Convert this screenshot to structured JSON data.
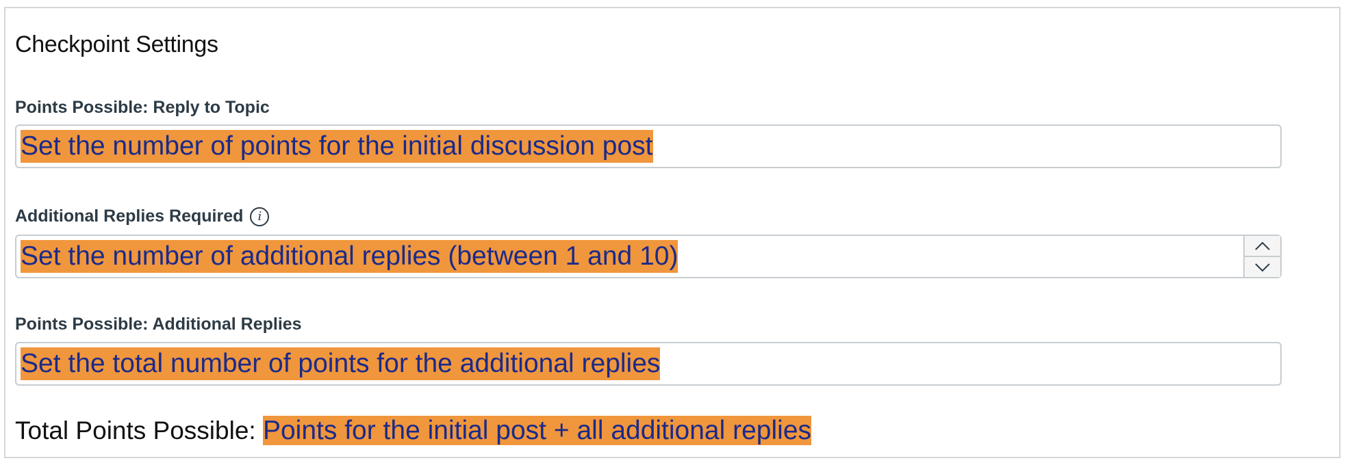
{
  "section": {
    "title": "Checkpoint Settings"
  },
  "reply_to_topic": {
    "label": "Points Possible: Reply to Topic",
    "value": "Set the number of points for the initial discussion post"
  },
  "additional_replies_required": {
    "label": "Additional Replies Required",
    "info_icon": "info-icon",
    "value": "Set the number of additional replies (between 1 and 10)",
    "stepper": {
      "up_icon": "chevron-up-icon",
      "down_icon": "chevron-down-icon"
    }
  },
  "additional_replies_points": {
    "label": "Points Possible: Additional Replies",
    "value": "Set the total number of points for the additional replies"
  },
  "total": {
    "label": "Total Points Possible:",
    "value": "Points for the initial post + all additional replies"
  },
  "colors": {
    "highlight": "#f0963c",
    "annotation_text": "#1a2a8a",
    "border": "#c7cdd1",
    "label_text": "#2d3b45"
  }
}
